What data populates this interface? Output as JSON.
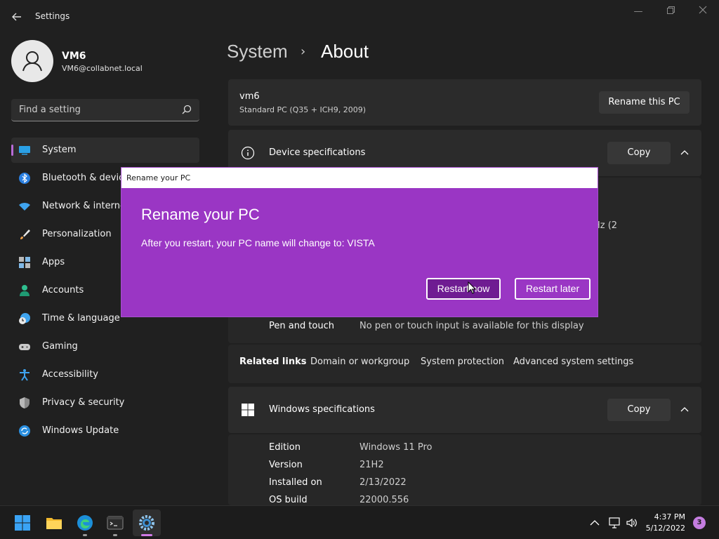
{
  "window": {
    "title": "Settings",
    "back_icon": "arrow-left-icon"
  },
  "profile": {
    "name": "VM6",
    "email": "VM6@collabnet.local"
  },
  "search": {
    "placeholder": "Find a setting"
  },
  "nav": {
    "items": [
      {
        "label": "System",
        "icon": "monitor-icon",
        "active": true
      },
      {
        "label": "Bluetooth & devices",
        "icon": "bluetooth-icon"
      },
      {
        "label": "Network & internet",
        "icon": "wifi-icon"
      },
      {
        "label": "Personalization",
        "icon": "brush-icon"
      },
      {
        "label": "Apps",
        "icon": "apps-icon"
      },
      {
        "label": "Accounts",
        "icon": "person-icon"
      },
      {
        "label": "Time & language",
        "icon": "clock-globe-icon"
      },
      {
        "label": "Gaming",
        "icon": "gamepad-icon"
      },
      {
        "label": "Accessibility",
        "icon": "accessibility-icon"
      },
      {
        "label": "Privacy & security",
        "icon": "shield-icon"
      },
      {
        "label": "Windows Update",
        "icon": "update-icon"
      }
    ]
  },
  "breadcrumb": {
    "parent": "System",
    "separator": "›",
    "current": "About"
  },
  "pc_card": {
    "name": "vm6",
    "model": "Standard PC (Q35 + ICH9, 2009)",
    "rename_label": "Rename this PC"
  },
  "device_specs": {
    "title": "Device specifications",
    "copy_label": "Copy",
    "partial_text": "Hz  (2",
    "pen_label": "Pen and touch",
    "pen_value": "No pen or touch input is available for this display"
  },
  "related_links": {
    "title": "Related links",
    "links": [
      "Domain or workgroup",
      "System protection",
      "Advanced system settings"
    ]
  },
  "windows_specs": {
    "title": "Windows specifications",
    "copy_label": "Copy",
    "rows": [
      {
        "label": "Edition",
        "value": "Windows 11 Pro"
      },
      {
        "label": "Version",
        "value": "21H2"
      },
      {
        "label": "Installed on",
        "value": "2/13/2022"
      },
      {
        "label": "OS build",
        "value": "22000.556"
      }
    ]
  },
  "dialog": {
    "window_title": "Rename your PC",
    "heading": "Rename your PC",
    "message": "After you restart, your PC name will change to: VISTA",
    "restart_now": "Restart now",
    "restart_later": "Restart later",
    "accent": "#9a36c4"
  },
  "taskbar": {
    "time": "4:37 PM",
    "date": "5/12/2022",
    "notifications": "3",
    "apps": [
      "windows-start-icon",
      "file-explorer-icon",
      "edge-icon",
      "terminal-icon",
      "settings-icon"
    ]
  }
}
